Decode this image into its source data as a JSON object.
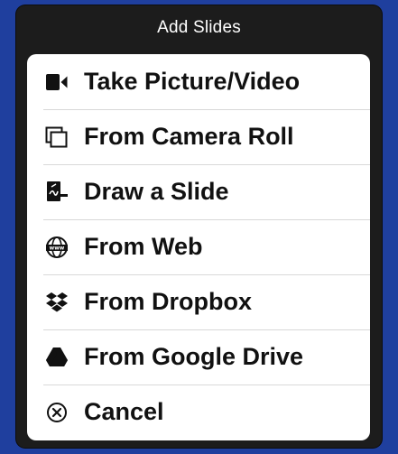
{
  "dialog": {
    "title": "Add Slides",
    "items": [
      {
        "label": "Take Picture/Video",
        "icon": "video-camera-icon"
      },
      {
        "label": "From Camera Roll",
        "icon": "photos-stack-icon"
      },
      {
        "label": "Draw a Slide",
        "icon": "draw-slide-icon"
      },
      {
        "label": "From Web",
        "icon": "globe-www-icon"
      },
      {
        "label": "From Dropbox",
        "icon": "dropbox-icon"
      },
      {
        "label": "From Google Drive",
        "icon": "google-drive-icon"
      },
      {
        "label": "Cancel",
        "icon": "cancel-circle-icon"
      }
    ]
  },
  "colors": {
    "background": "#1f3f9e",
    "sheet": "#1c1c1c",
    "panel": "#ffffff",
    "text": "#111111",
    "separator": "#d8d8d8"
  }
}
